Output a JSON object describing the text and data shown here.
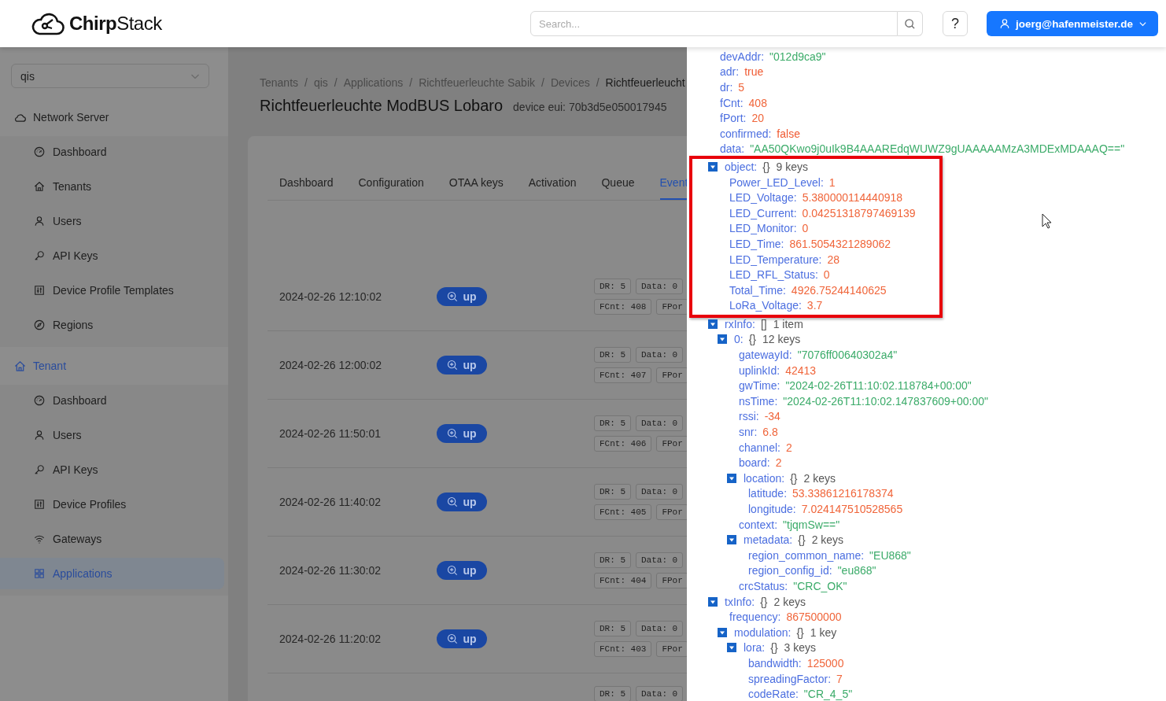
{
  "header": {
    "logo": "**Chirp**Stack",
    "search": {
      "placeholder": "Search..."
    },
    "help": "?",
    "user": "joerg@hafenmeister.de"
  },
  "sidebar": {
    "tenant_select": "qis",
    "groups": [
      {
        "label": "Network Server",
        "active": false,
        "items": [
          {
            "label": "Dashboard",
            "selected": false
          },
          {
            "label": "Tenants",
            "selected": false
          },
          {
            "label": "Users",
            "selected": false
          },
          {
            "label": "API Keys",
            "selected": false
          },
          {
            "label": "Device Profile Templates",
            "selected": false
          },
          {
            "label": "Regions",
            "selected": false
          }
        ]
      },
      {
        "label": "Tenant",
        "active": true,
        "items": [
          {
            "label": "Dashboard",
            "selected": false
          },
          {
            "label": "Users",
            "selected": false
          },
          {
            "label": "API Keys",
            "selected": false
          },
          {
            "label": "Device Profiles",
            "selected": false
          },
          {
            "label": "Gateways",
            "selected": false
          },
          {
            "label": "Applications",
            "selected": true
          }
        ]
      }
    ]
  },
  "breadcrumb": {
    "separator": "/",
    "items": [
      "Tenants",
      "qis",
      "Applications",
      "Richtfeuerleuchte Sabik",
      "Devices",
      "Richtfeuerleucht"
    ]
  },
  "page": {
    "title": "Richtfeuerleuchte ModBUS Lobaro",
    "subtitle": "device eui: 70b3d5e050017945"
  },
  "tabs": [
    {
      "label": "Dashboard",
      "selected": false
    },
    {
      "label": "Configuration",
      "selected": false
    },
    {
      "label": "OTAA keys",
      "selected": false
    },
    {
      "label": "Activation",
      "selected": false
    },
    {
      "label": "Queue",
      "selected": false
    },
    {
      "label": "Event",
      "selected": true
    }
  ],
  "events": [
    {
      "time": "2024-02-26 12:10:02",
      "button": "up",
      "tags": [
        "DR: 5",
        "Data: 0",
        "FCnt: 408",
        "FPor"
      ]
    },
    {
      "time": "2024-02-26 12:00:02",
      "button": "up",
      "tags": [
        "DR: 5",
        "Data: 0",
        "FCnt: 407",
        "FPor"
      ]
    },
    {
      "time": "2024-02-26 11:50:01",
      "button": "up",
      "tags": [
        "DR: 5",
        "Data: 0",
        "FCnt: 406",
        "FPor"
      ]
    },
    {
      "time": "2024-02-26 11:40:02",
      "button": "up",
      "tags": [
        "DR: 5",
        "Data: 0",
        "FCnt: 405",
        "FPor"
      ]
    },
    {
      "time": "2024-02-26 11:30:02",
      "button": "up",
      "tags": [
        "DR: 5",
        "Data: 0",
        "FCnt: 404",
        "FPor"
      ]
    },
    {
      "time": "2024-02-26 11:20:02",
      "button": "up",
      "tags": [
        "DR: 5",
        "Data: 0",
        "FCnt: 403",
        "FPor"
      ]
    },
    {
      "tags": [
        "DR: 5",
        "Data: 0"
      ]
    }
  ],
  "drawer": {
    "tree": [
      {
        "kind": "string",
        "key": "devAddr:",
        "value": "\"012d9ca9\"",
        "highlighted": false
      },
      {
        "kind": "boolean",
        "key": "adr:",
        "value": "true",
        "highlighted": false
      },
      {
        "kind": "number",
        "key": "dr:",
        "value": "5",
        "highlighted": false
      },
      {
        "kind": "number",
        "key": "fCnt:",
        "value": "408",
        "highlighted": false
      },
      {
        "kind": "number",
        "key": "fPort:",
        "value": "20",
        "highlighted": false
      },
      {
        "kind": "boolean",
        "key": "confirmed:",
        "value": "false",
        "highlighted": false
      },
      {
        "kind": "string",
        "key": "data:",
        "value": "\"AA50QKwo9j0uIk9B4AAAREdqWUWZ9gUAAAAAMzA3MDExMDAAAQ==\"",
        "highlighted": false
      },
      {
        "kind": "branch",
        "key": "object:",
        "bracket": "{}",
        "summary": "9 keys",
        "expanded": true,
        "highlighted": true,
        "children": [
          {
            "kind": "number",
            "key": "Power_LED_Level:",
            "value": "1"
          },
          {
            "kind": "number",
            "key": "LED_Voltage:",
            "value": "5.380000114440918"
          },
          {
            "kind": "number",
            "key": "LED_Current:",
            "value": "0.04251318797469139"
          },
          {
            "kind": "number",
            "key": "LED_Monitor:",
            "value": "0"
          },
          {
            "kind": "number",
            "key": "LED_Time:",
            "value": "861.5054321289062"
          },
          {
            "kind": "number",
            "key": "LED_Temperature:",
            "value": "28"
          },
          {
            "kind": "number",
            "key": "LED_RFL_Status:",
            "value": "0"
          },
          {
            "kind": "number",
            "key": "Total_Time:",
            "value": "4926.75244140625"
          },
          {
            "kind": "number",
            "key": "LoRa_Voltage:",
            "value": "3.7"
          }
        ]
      },
      {
        "kind": "branch",
        "key": "rxInfo:",
        "bracket": "[]",
        "summary": "1 item",
        "expanded": true,
        "highlighted": false,
        "children": [
          {
            "kind": "branch",
            "key": "0:",
            "bracket": "{}",
            "summary": "12 keys",
            "expanded": true,
            "children": [
              {
                "kind": "string",
                "key": "gatewayId:",
                "value": "\"7076ff00640302a4\""
              },
              {
                "kind": "number",
                "key": "uplinkId:",
                "value": "42413"
              },
              {
                "kind": "string",
                "key": "gwTime:",
                "value": "\"2024-02-26T11:10:02.118784+00:00\""
              },
              {
                "kind": "string",
                "key": "nsTime:",
                "value": "\"2024-02-26T11:10:02.147837609+00:00\""
              },
              {
                "kind": "number",
                "key": "rssi:",
                "value": "-34"
              },
              {
                "kind": "number",
                "key": "snr:",
                "value": "6.8"
              },
              {
                "kind": "number",
                "key": "channel:",
                "value": "2"
              },
              {
                "kind": "number",
                "key": "board:",
                "value": "2"
              },
              {
                "kind": "branch",
                "key": "location:",
                "bracket": "{}",
                "summary": "2 keys",
                "expanded": true,
                "children": [
                  {
                    "kind": "number",
                    "key": "latitude:",
                    "value": "53.33861216178374"
                  },
                  {
                    "kind": "number",
                    "key": "longitude:",
                    "value": "7.024147510528565"
                  }
                ]
              },
              {
                "kind": "string",
                "key": "context:",
                "value": "\"tjqmSw==\""
              },
              {
                "kind": "branch",
                "key": "metadata:",
                "bracket": "{}",
                "summary": "2 keys",
                "expanded": true,
                "children": [
                  {
                    "kind": "string",
                    "key": "region_common_name:",
                    "value": "\"EU868\""
                  },
                  {
                    "kind": "string",
                    "key": "region_config_id:",
                    "value": "\"eu868\""
                  }
                ]
              },
              {
                "kind": "string",
                "key": "crcStatus:",
                "value": "\"CRC_OK\""
              }
            ]
          }
        ]
      },
      {
        "kind": "branch",
        "key": "txInfo:",
        "bracket": "{}",
        "summary": "2 keys",
        "expanded": true,
        "highlighted": false,
        "children": [
          {
            "kind": "number",
            "key": "frequency:",
            "value": "867500000"
          },
          {
            "kind": "branch",
            "key": "modulation:",
            "bracket": "{}",
            "summary": "1 key",
            "expanded": true,
            "children": [
              {
                "kind": "branch",
                "key": "lora:",
                "bracket": "{}",
                "summary": "3 keys",
                "expanded": true,
                "children": [
                  {
                    "kind": "number",
                    "key": "bandwidth:",
                    "value": "125000"
                  },
                  {
                    "kind": "number",
                    "key": "spreadingFactor:",
                    "value": "7"
                  },
                  {
                    "kind": "string",
                    "key": "codeRate:",
                    "value": "\"CR_4_5\""
                  }
                ]
              }
            ]
          }
        ]
      }
    ]
  }
}
